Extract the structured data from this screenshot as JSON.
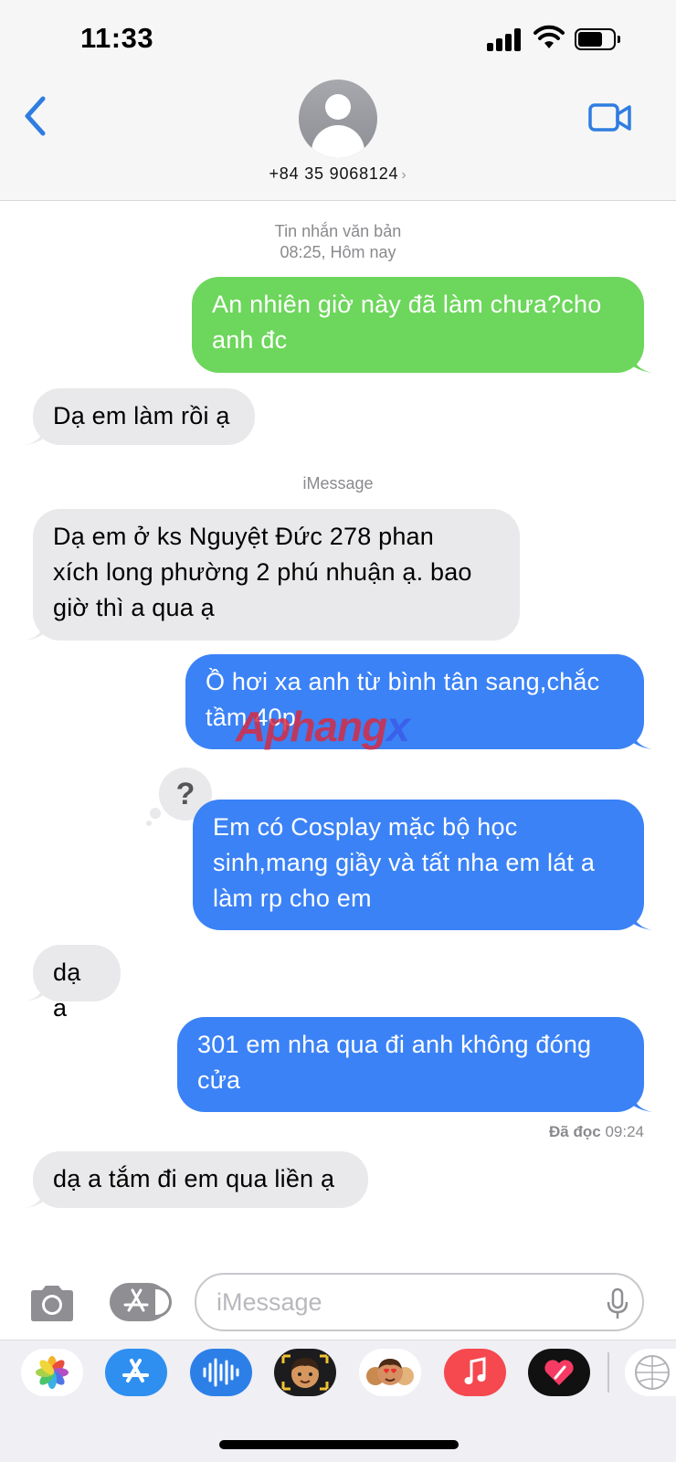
{
  "status_bar": {
    "time": "11:33"
  },
  "header": {
    "contact": "+84 35 9068124",
    "contact_chevron": "›",
    "back_icon": "chevron-left-icon",
    "video_icon": "video-camera-icon"
  },
  "thread": {
    "sms_label": "Tin nhắn văn bản",
    "sms_time": "08:25, Hôm nay",
    "imessage_label": "iMessage",
    "messages": [
      {
        "from": "me",
        "service": "sms",
        "lines": [
          "An nhiên giờ này đã làm chưa?cho",
          "anh đc"
        ]
      },
      {
        "from": "them",
        "lines": [
          "Dạ em làm rồi ạ"
        ]
      },
      {
        "from": "them",
        "lines": [
          "Dạ em ở ks Nguyệt Đức 278  phan",
          "xích long phường 2 phú nhuận ạ. bao",
          "giờ thì a qua ạ"
        ]
      },
      {
        "from": "me",
        "service": "imessage",
        "lines": [
          "Ồ hơi xa anh từ bình tân sang,chắc",
          "tầm 40p"
        ]
      },
      {
        "from": "me",
        "service": "imessage",
        "reaction": "?",
        "lines": [
          "Em có Cosplay mặc bộ học",
          "sinh,mang giầy và tất nha em lát a",
          "làm rp cho em"
        ]
      },
      {
        "from": "them",
        "lines": [
          "dạ a"
        ]
      },
      {
        "from": "me",
        "service": "imessage",
        "lines": [
          "301 em nha qua đi anh không đóng",
          "cửa"
        ]
      },
      {
        "from": "them",
        "lines": [
          "dạ a tắm đi em qua liền ạ"
        ]
      }
    ],
    "read_receipt": {
      "label": "Đã đọc",
      "time": "09:24"
    }
  },
  "watermark": {
    "part1": "Aphang",
    "part2": "x"
  },
  "composer": {
    "placeholder": "iMessage"
  },
  "app_drawer": [
    "photos-icon",
    "app-store-icon",
    "audio-message-icon",
    "memoji-icon",
    "memoji-stickers-icon",
    "music-icon",
    "digital-touch-icon",
    "more-apps-icon"
  ],
  "colors": {
    "imessage_blue": "#3b82f6",
    "sms_green": "#6dd65c",
    "received_gray": "#e9e9eb",
    "ios_blue": "#2f7de1"
  }
}
